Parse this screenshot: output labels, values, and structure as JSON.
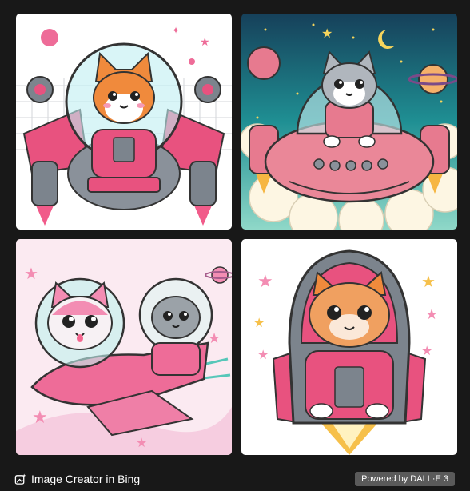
{
  "footer": {
    "brand_label": "Image Creator in Bing",
    "badge_label": "Powered by DALL·E 3"
  },
  "images": [
    {
      "subject": "cat-in-pink-spaceship-robot",
      "bg": "#ffffff"
    },
    {
      "subject": "cat-in-pink-spaceship-clouds",
      "bg": "#1f8f93"
    },
    {
      "subject": "two-cats-on-pink-rocket",
      "bg": "#fbeaf1"
    },
    {
      "subject": "cat-in-rocket-capsule",
      "bg": "#ffffff"
    }
  ],
  "colors": {
    "pink": "#e8527f",
    "teal": "#4fc3c9",
    "grey": "#7c848d"
  }
}
